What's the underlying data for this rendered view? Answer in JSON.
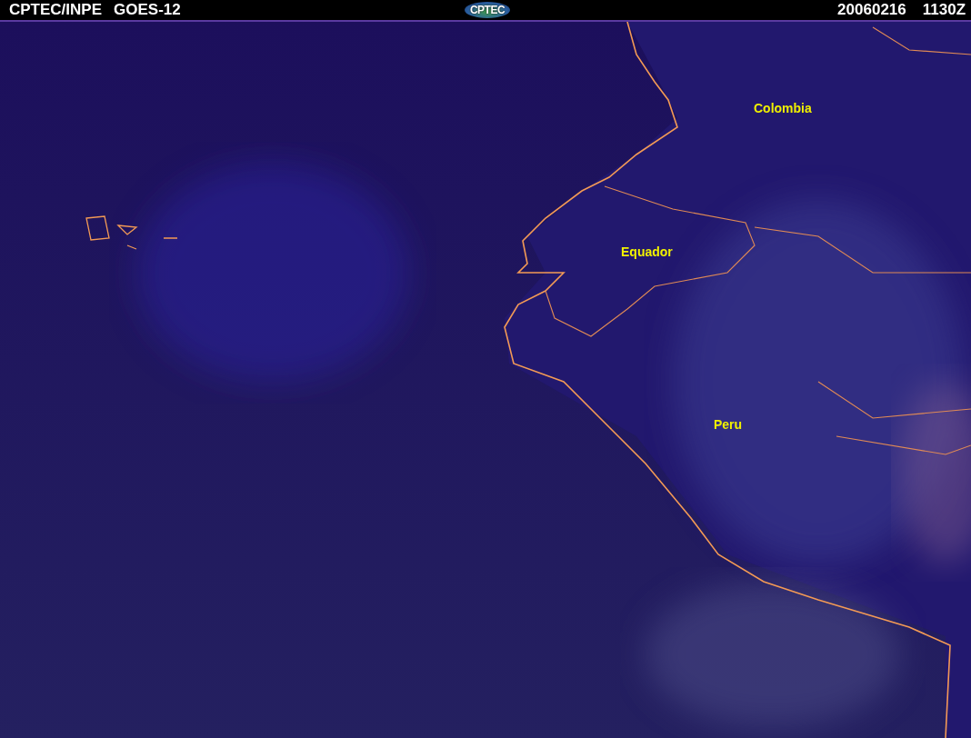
{
  "header": {
    "agency": "CPTEC/INPE",
    "satellite": "GOES-12",
    "logo": "CPTEC",
    "date": "20060216",
    "time": "1130Z"
  },
  "map": {
    "labels": [
      {
        "text": "Colombia"
      },
      {
        "text": "Equador"
      },
      {
        "text": "Peru"
      }
    ]
  }
}
